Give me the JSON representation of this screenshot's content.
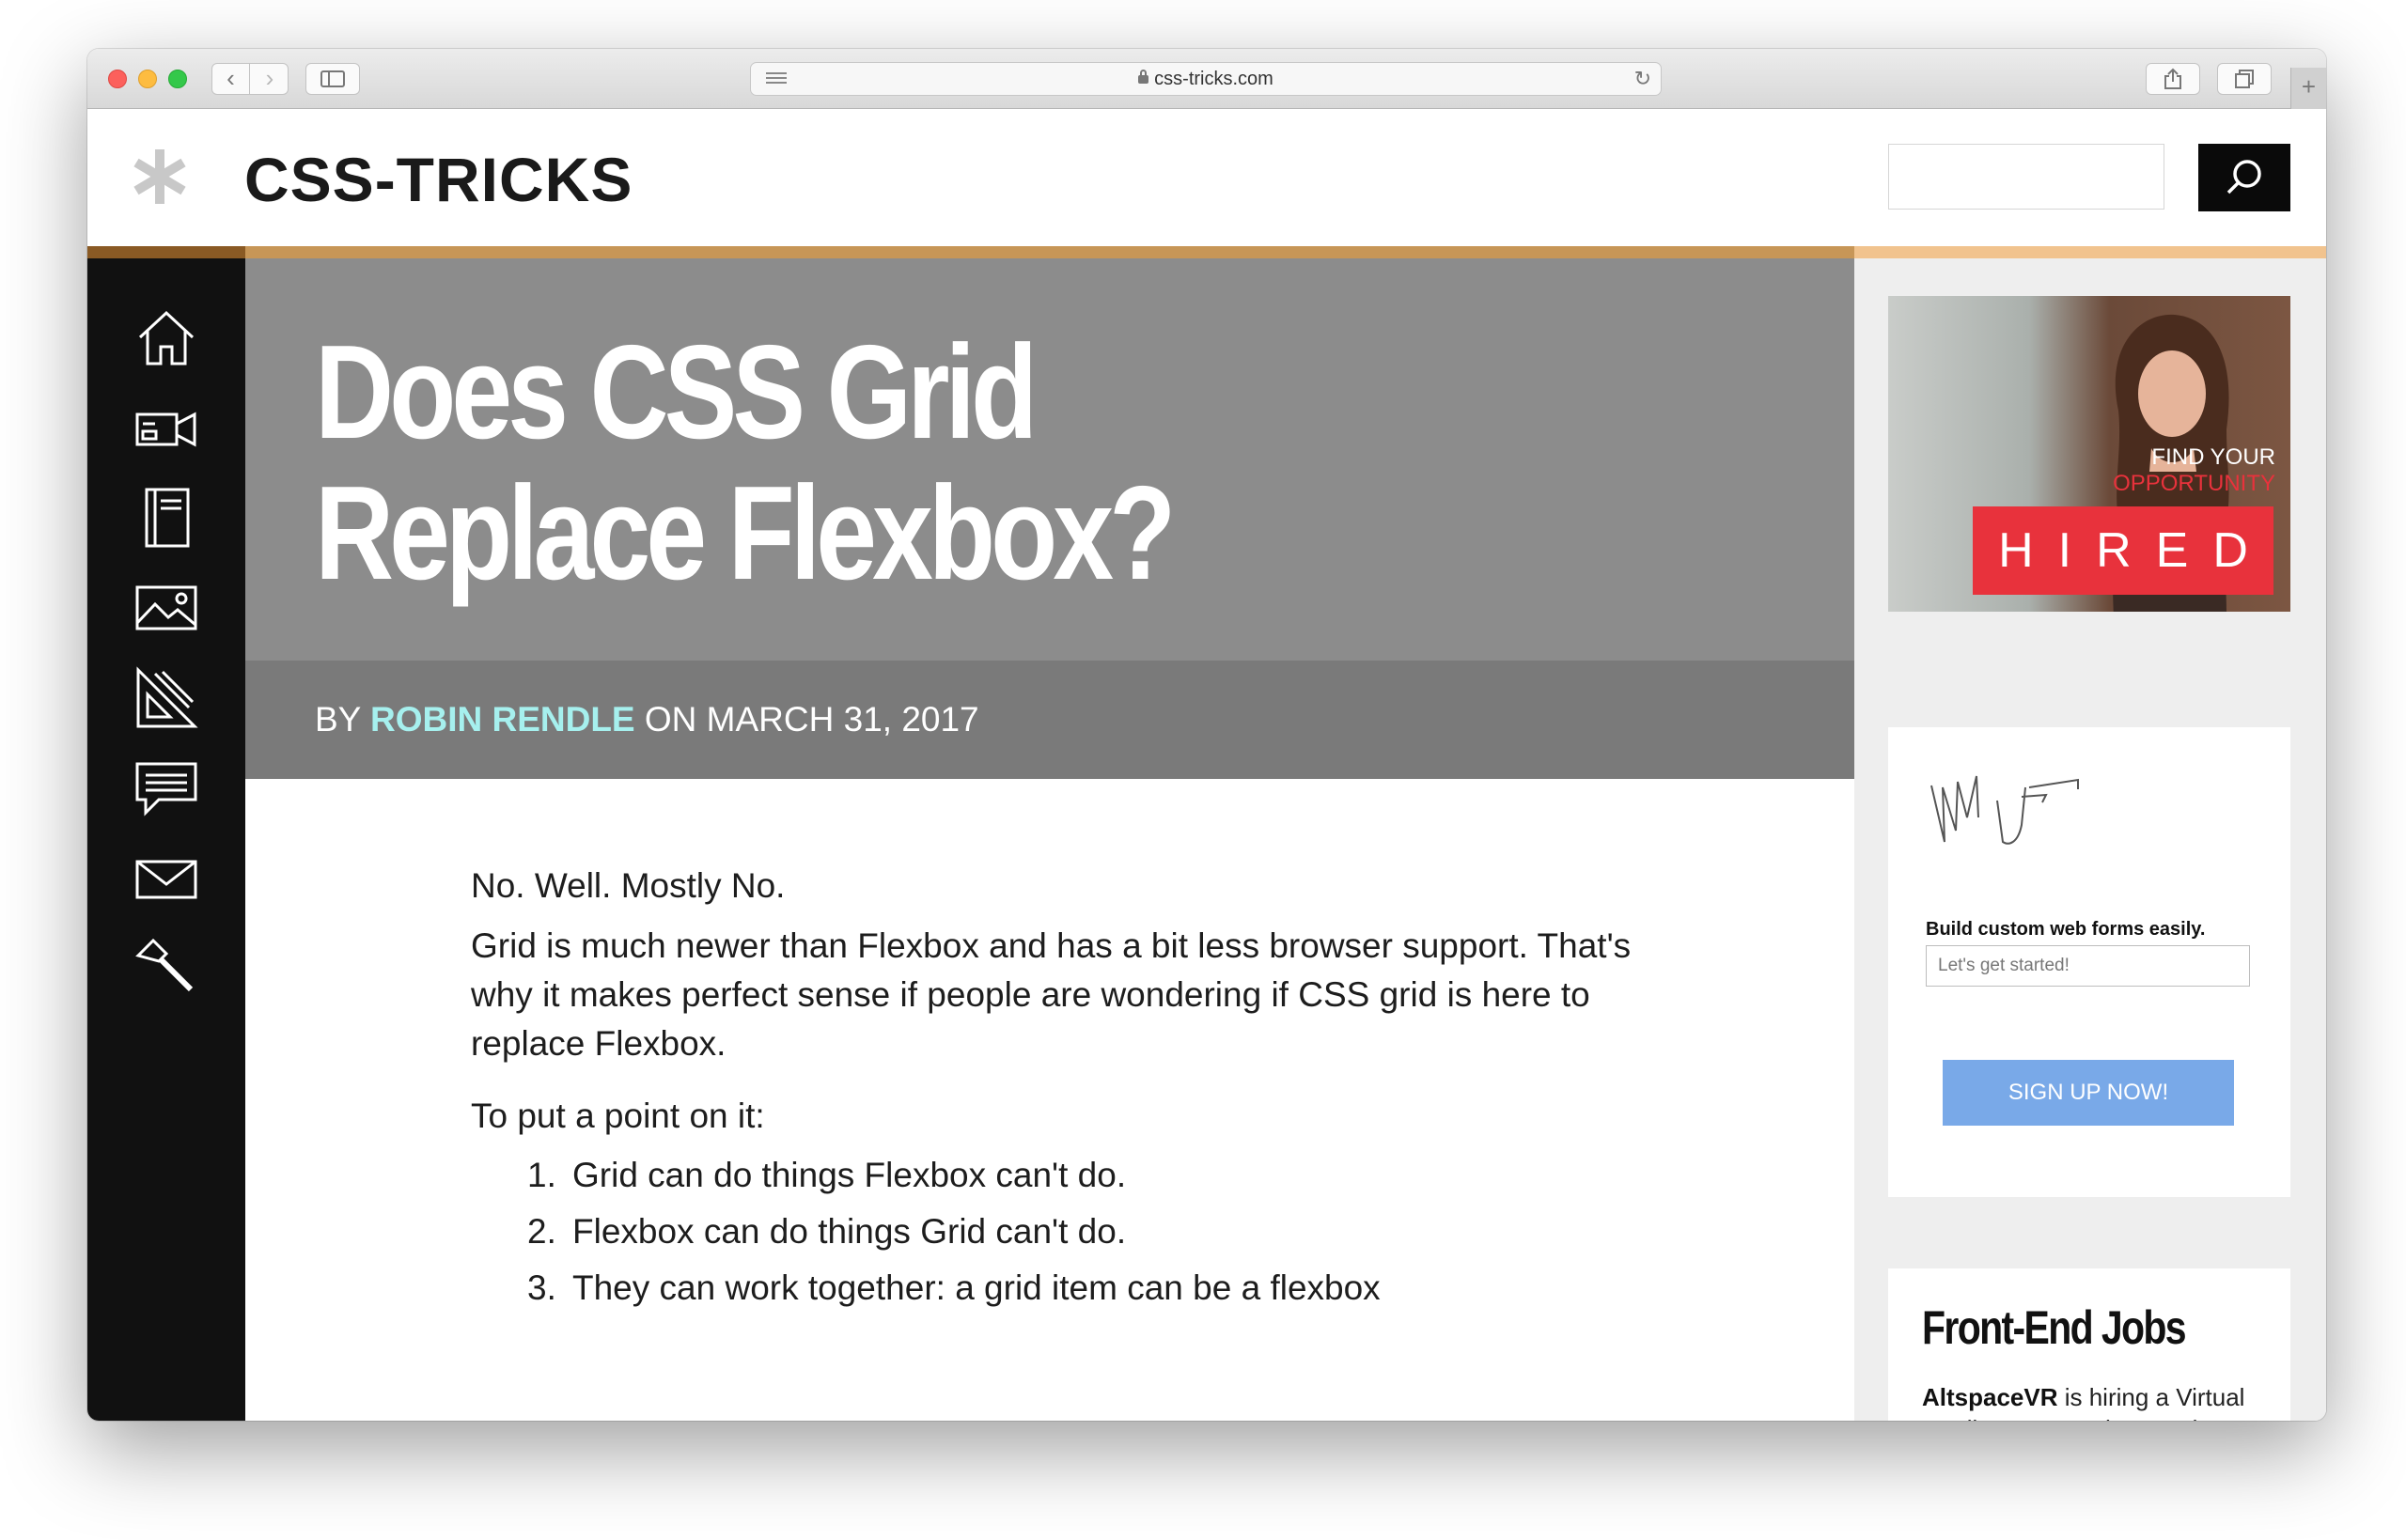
{
  "browser": {
    "url": "css-tricks.com"
  },
  "site": {
    "logo_text": "CSS-TRICKS"
  },
  "nav": {
    "items": [
      {
        "icon": "home-icon"
      },
      {
        "icon": "video-camera-icon"
      },
      {
        "icon": "almanac-book-icon"
      },
      {
        "icon": "image-icon"
      },
      {
        "icon": "drafting-tools-icon"
      },
      {
        "icon": "forums-chat-icon"
      },
      {
        "icon": "mail-icon"
      },
      {
        "icon": "hammer-icon"
      }
    ]
  },
  "article": {
    "title_line1": "Does CSS Grid",
    "title_line2": "Replace Flexbox?",
    "byline_prefix": "BY",
    "author": "ROBIN RENDLE",
    "byline_date": "ON MARCH 31, 2017",
    "p1": "No. Well. Mostly No.",
    "p2": "Grid is much newer than Flexbox and has a bit less browser support. That's why it makes perfect sense if people are wondering if CSS grid is here to replace Flexbox.",
    "p3": "To put a point on it:",
    "list": [
      {
        "num": "1.",
        "text": "Grid can do things Flexbox can't do."
      },
      {
        "num": "2.",
        "text": "Flexbox can do things Grid can't do."
      },
      {
        "num": "3.",
        "text": "They can work together: a grid item can be a flexbox"
      }
    ]
  },
  "sidebar": {
    "search_placeholder": "",
    "ad_hired": {
      "tagline_line1": "FIND YOUR",
      "tagline_line2": "OPPORTUNITY",
      "brand": "HIRED"
    },
    "ad_form": {
      "title": "Build custom web forms easily.",
      "field_placeholder": "Let's get started!",
      "button": "SIGN UP NOW!"
    },
    "jobs": {
      "heading": "Front-End Jobs",
      "company": "AltspaceVR",
      "text": " is hiring a Virtual Reality Front End UI Engineer"
    }
  },
  "colors": {
    "accent_orange": "#c79657",
    "author_link": "#a6f0ee",
    "hired_red": "#e8323c",
    "signup_blue": "#79a9e8"
  }
}
